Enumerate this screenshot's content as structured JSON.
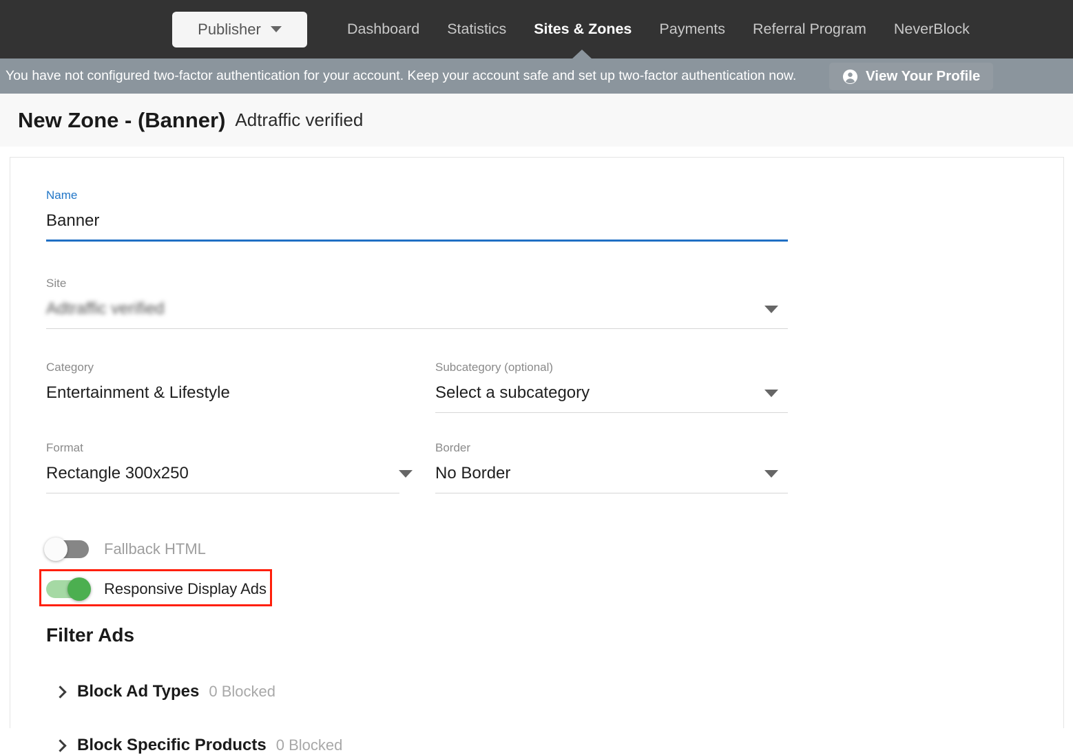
{
  "topnav": {
    "publisher_button": {
      "label": "Publisher",
      "icon": "chevron-down-icon"
    },
    "links": [
      {
        "label": "Dashboard",
        "active": false
      },
      {
        "label": "Statistics",
        "active": false
      },
      {
        "label": "Sites & Zones",
        "active": true
      },
      {
        "label": "Payments",
        "active": false
      },
      {
        "label": "Referral Program",
        "active": false
      },
      {
        "label": "NeverBlock",
        "active": false
      }
    ]
  },
  "notice": {
    "message": "You have not configured two-factor authentication for your account. Keep your account safe and set up two-factor authentication now.",
    "button_label": "View Your Profile",
    "button_icon": "account-circle-icon",
    "background_color": "#8b959d"
  },
  "page_header": {
    "title": "New Zone - (Banner)",
    "subtitle": "Adtraffic verified"
  },
  "form": {
    "name": {
      "label": "Name",
      "value": "Banner",
      "focused": true,
      "accent_color": "#1f6fc4"
    },
    "site": {
      "label": "Site",
      "value": "Adtraffic verified",
      "redacted": true,
      "icon": "chevron-down-icon"
    },
    "category": {
      "label": "Category",
      "value": "Entertainment & Lifestyle"
    },
    "subcategory": {
      "label": "Subcategory (optional)",
      "value": "Select a subcategory",
      "icon": "chevron-down-icon"
    },
    "format": {
      "label": "Format",
      "value": "Rectangle 300x250",
      "icon": "chevron-down-icon"
    },
    "border": {
      "label": "Border",
      "value": "No Border",
      "icon": "chevron-down-icon"
    }
  },
  "toggles": [
    {
      "label": "Fallback HTML",
      "state": "off",
      "highlighted": false
    },
    {
      "label": "Responsive Display Ads",
      "state": "on",
      "highlighted": true,
      "highlight_color": "#ff1f0a",
      "on_color": "#4caf50"
    }
  ],
  "filter_ads": {
    "title": "Filter Ads",
    "items": [
      {
        "label": "Block Ad Types",
        "count": "0 Blocked",
        "icon": "chevron-right-icon"
      },
      {
        "label": "Block Specific Products",
        "count": "0 Blocked",
        "icon": "chevron-right-icon"
      }
    ]
  }
}
